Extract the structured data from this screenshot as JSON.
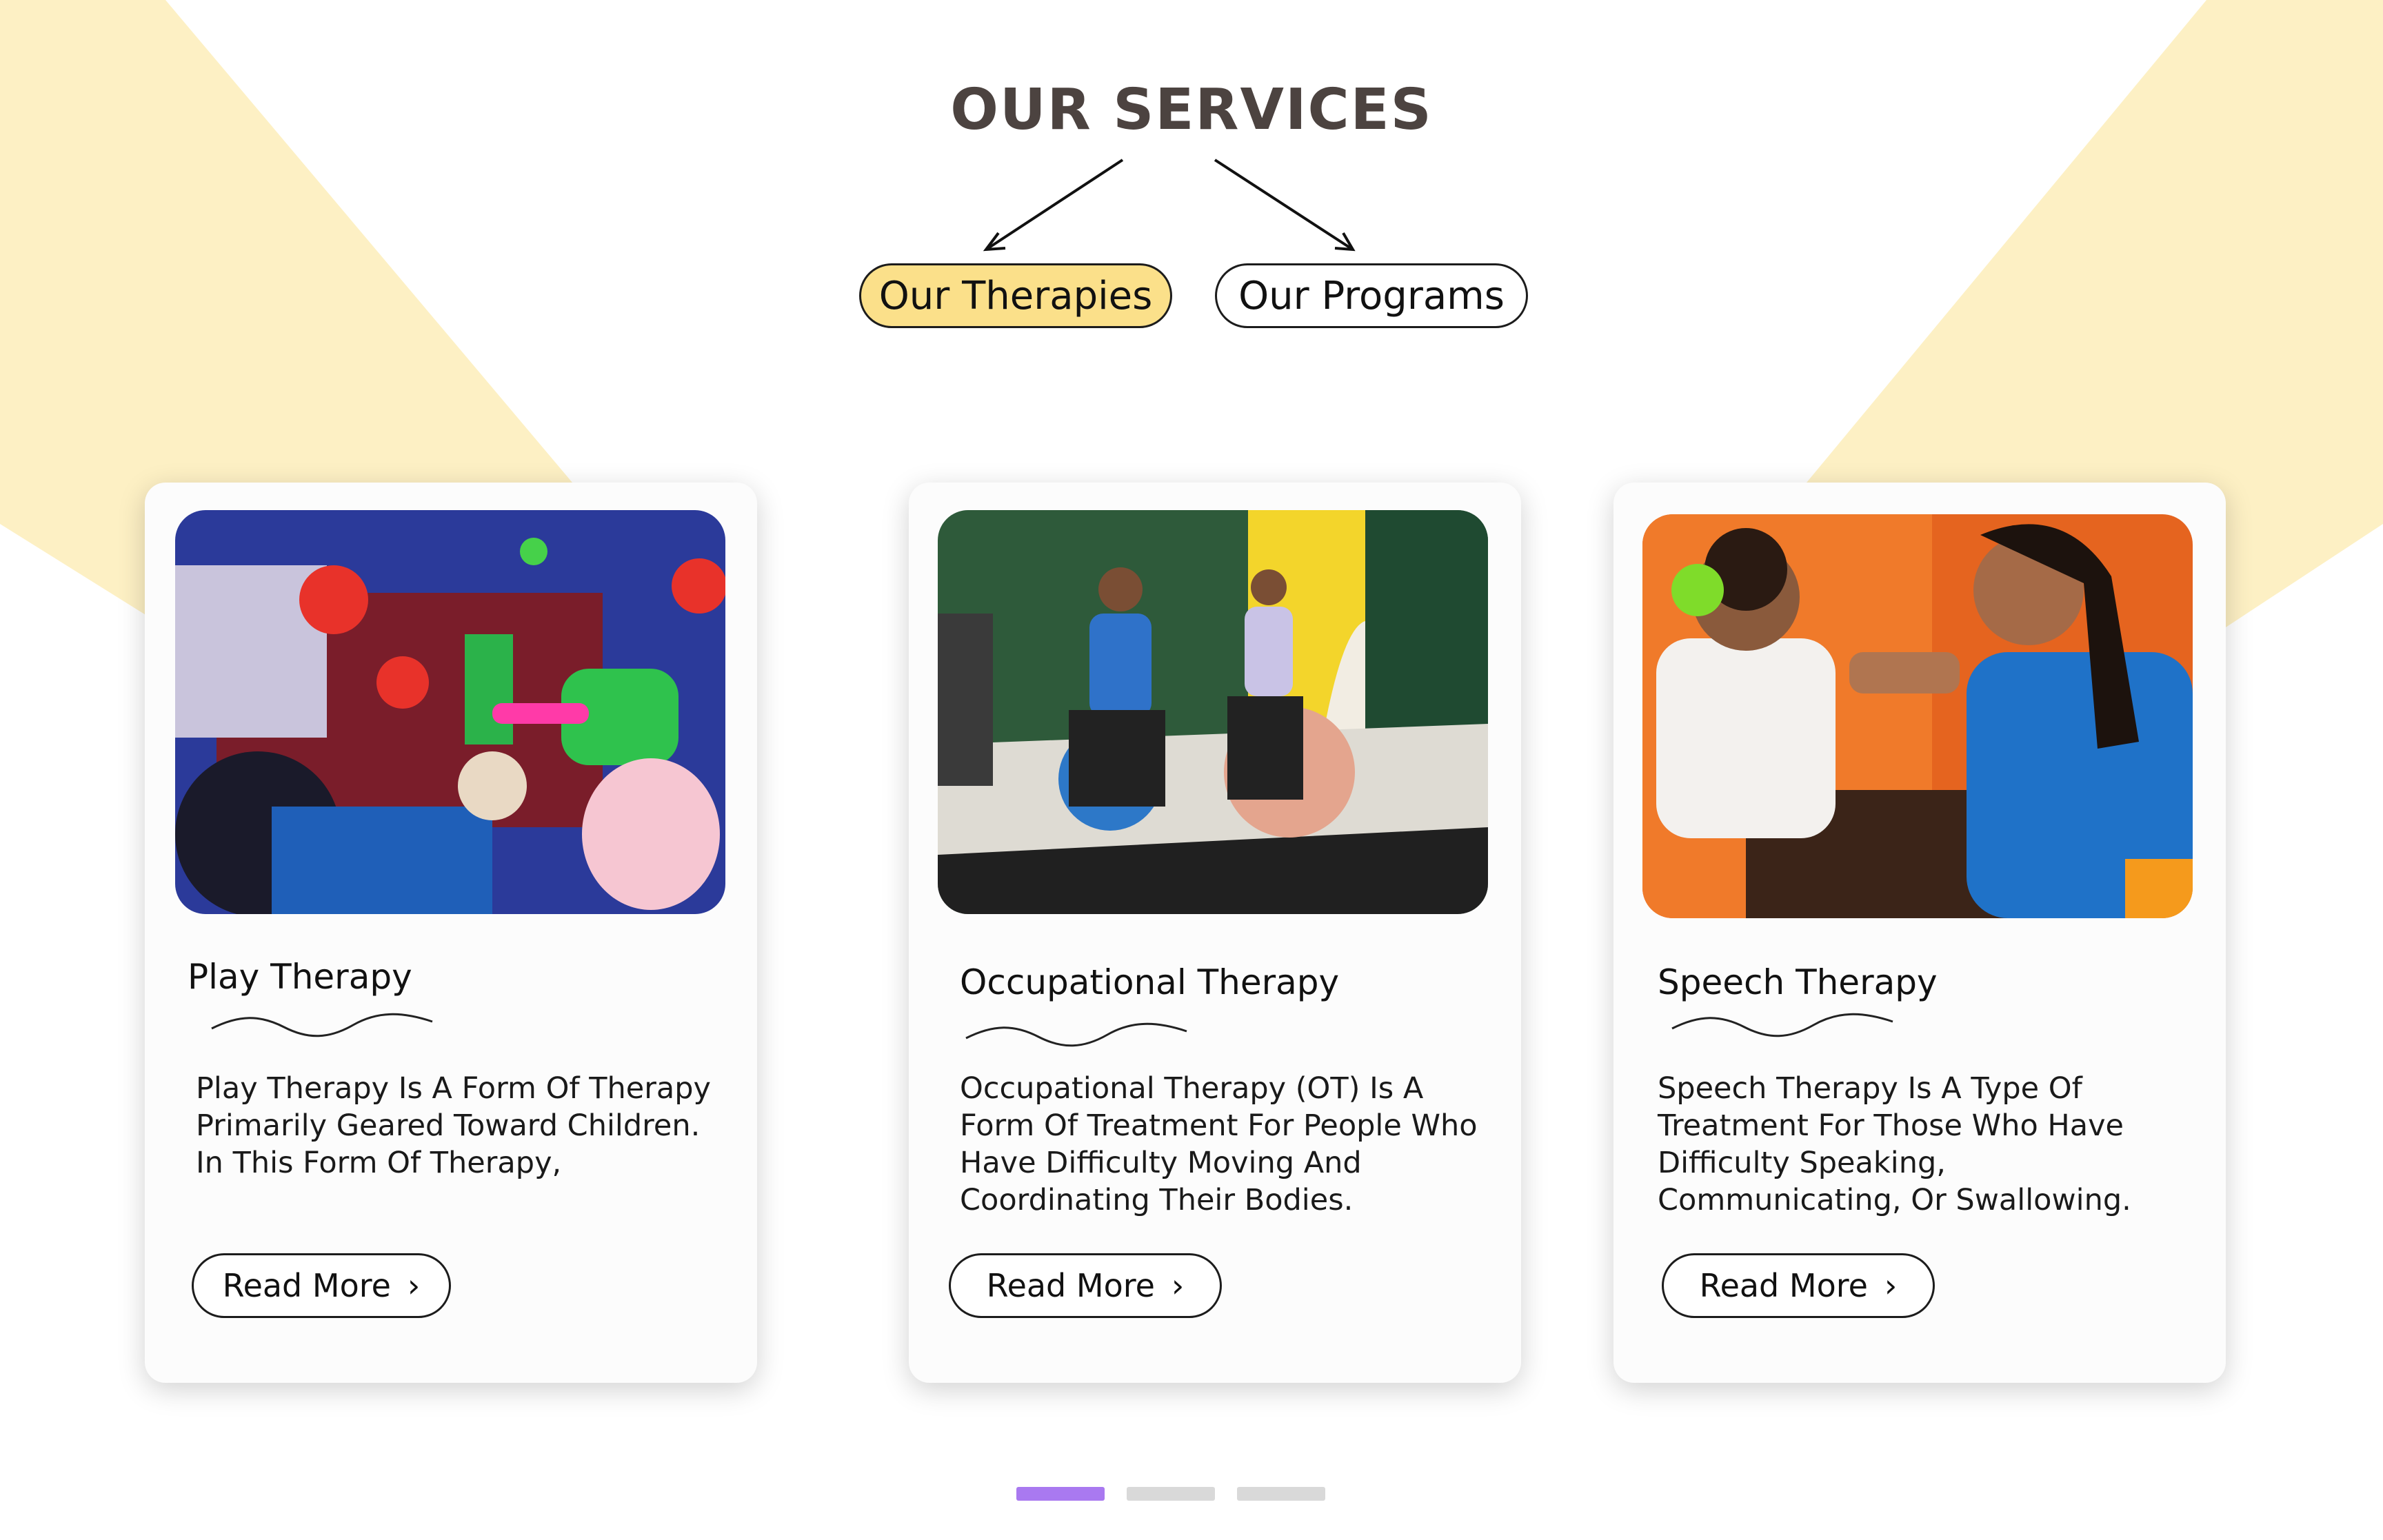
{
  "section": {
    "title": "OUR SERVICES"
  },
  "tabs": [
    {
      "label": "Our Therapies",
      "active": true
    },
    {
      "label": "Our Programs",
      "active": false
    }
  ],
  "cards": [
    {
      "title": "Play Therapy",
      "description": "Play Therapy Is A Form Of Therapy Primarily Geared Toward Children. In This Form Of Therapy,",
      "button": "Read More",
      "image": "children-playing-with-toys-photo"
    },
    {
      "title": "Occupational Therapy",
      "description": "Occupational Therapy (OT) Is A Form Of Treatment For People Who Have Difficulty Moving And Coordinating Their Bodies.",
      "button": "Read More",
      "image": "therapist-and-child-on-exercise-balls-photo"
    },
    {
      "title": "Speech Therapy",
      "description": "Speech Therapy Is A Type Of Treatment For Those Who Have Difficulty Speaking, Communicating, Or Swallowing.",
      "button": "Read More",
      "image": "therapist-and-child-speech-session-photo"
    }
  ],
  "carousel": {
    "page_count": 3,
    "active_index": 0
  },
  "colors": {
    "accent_yellow": "#fbe08a",
    "background_shape": "#fdf0c4",
    "title_text": "#4c4340",
    "active_dot": "#a979f0",
    "inactive_dot": "#d9d9d9"
  }
}
